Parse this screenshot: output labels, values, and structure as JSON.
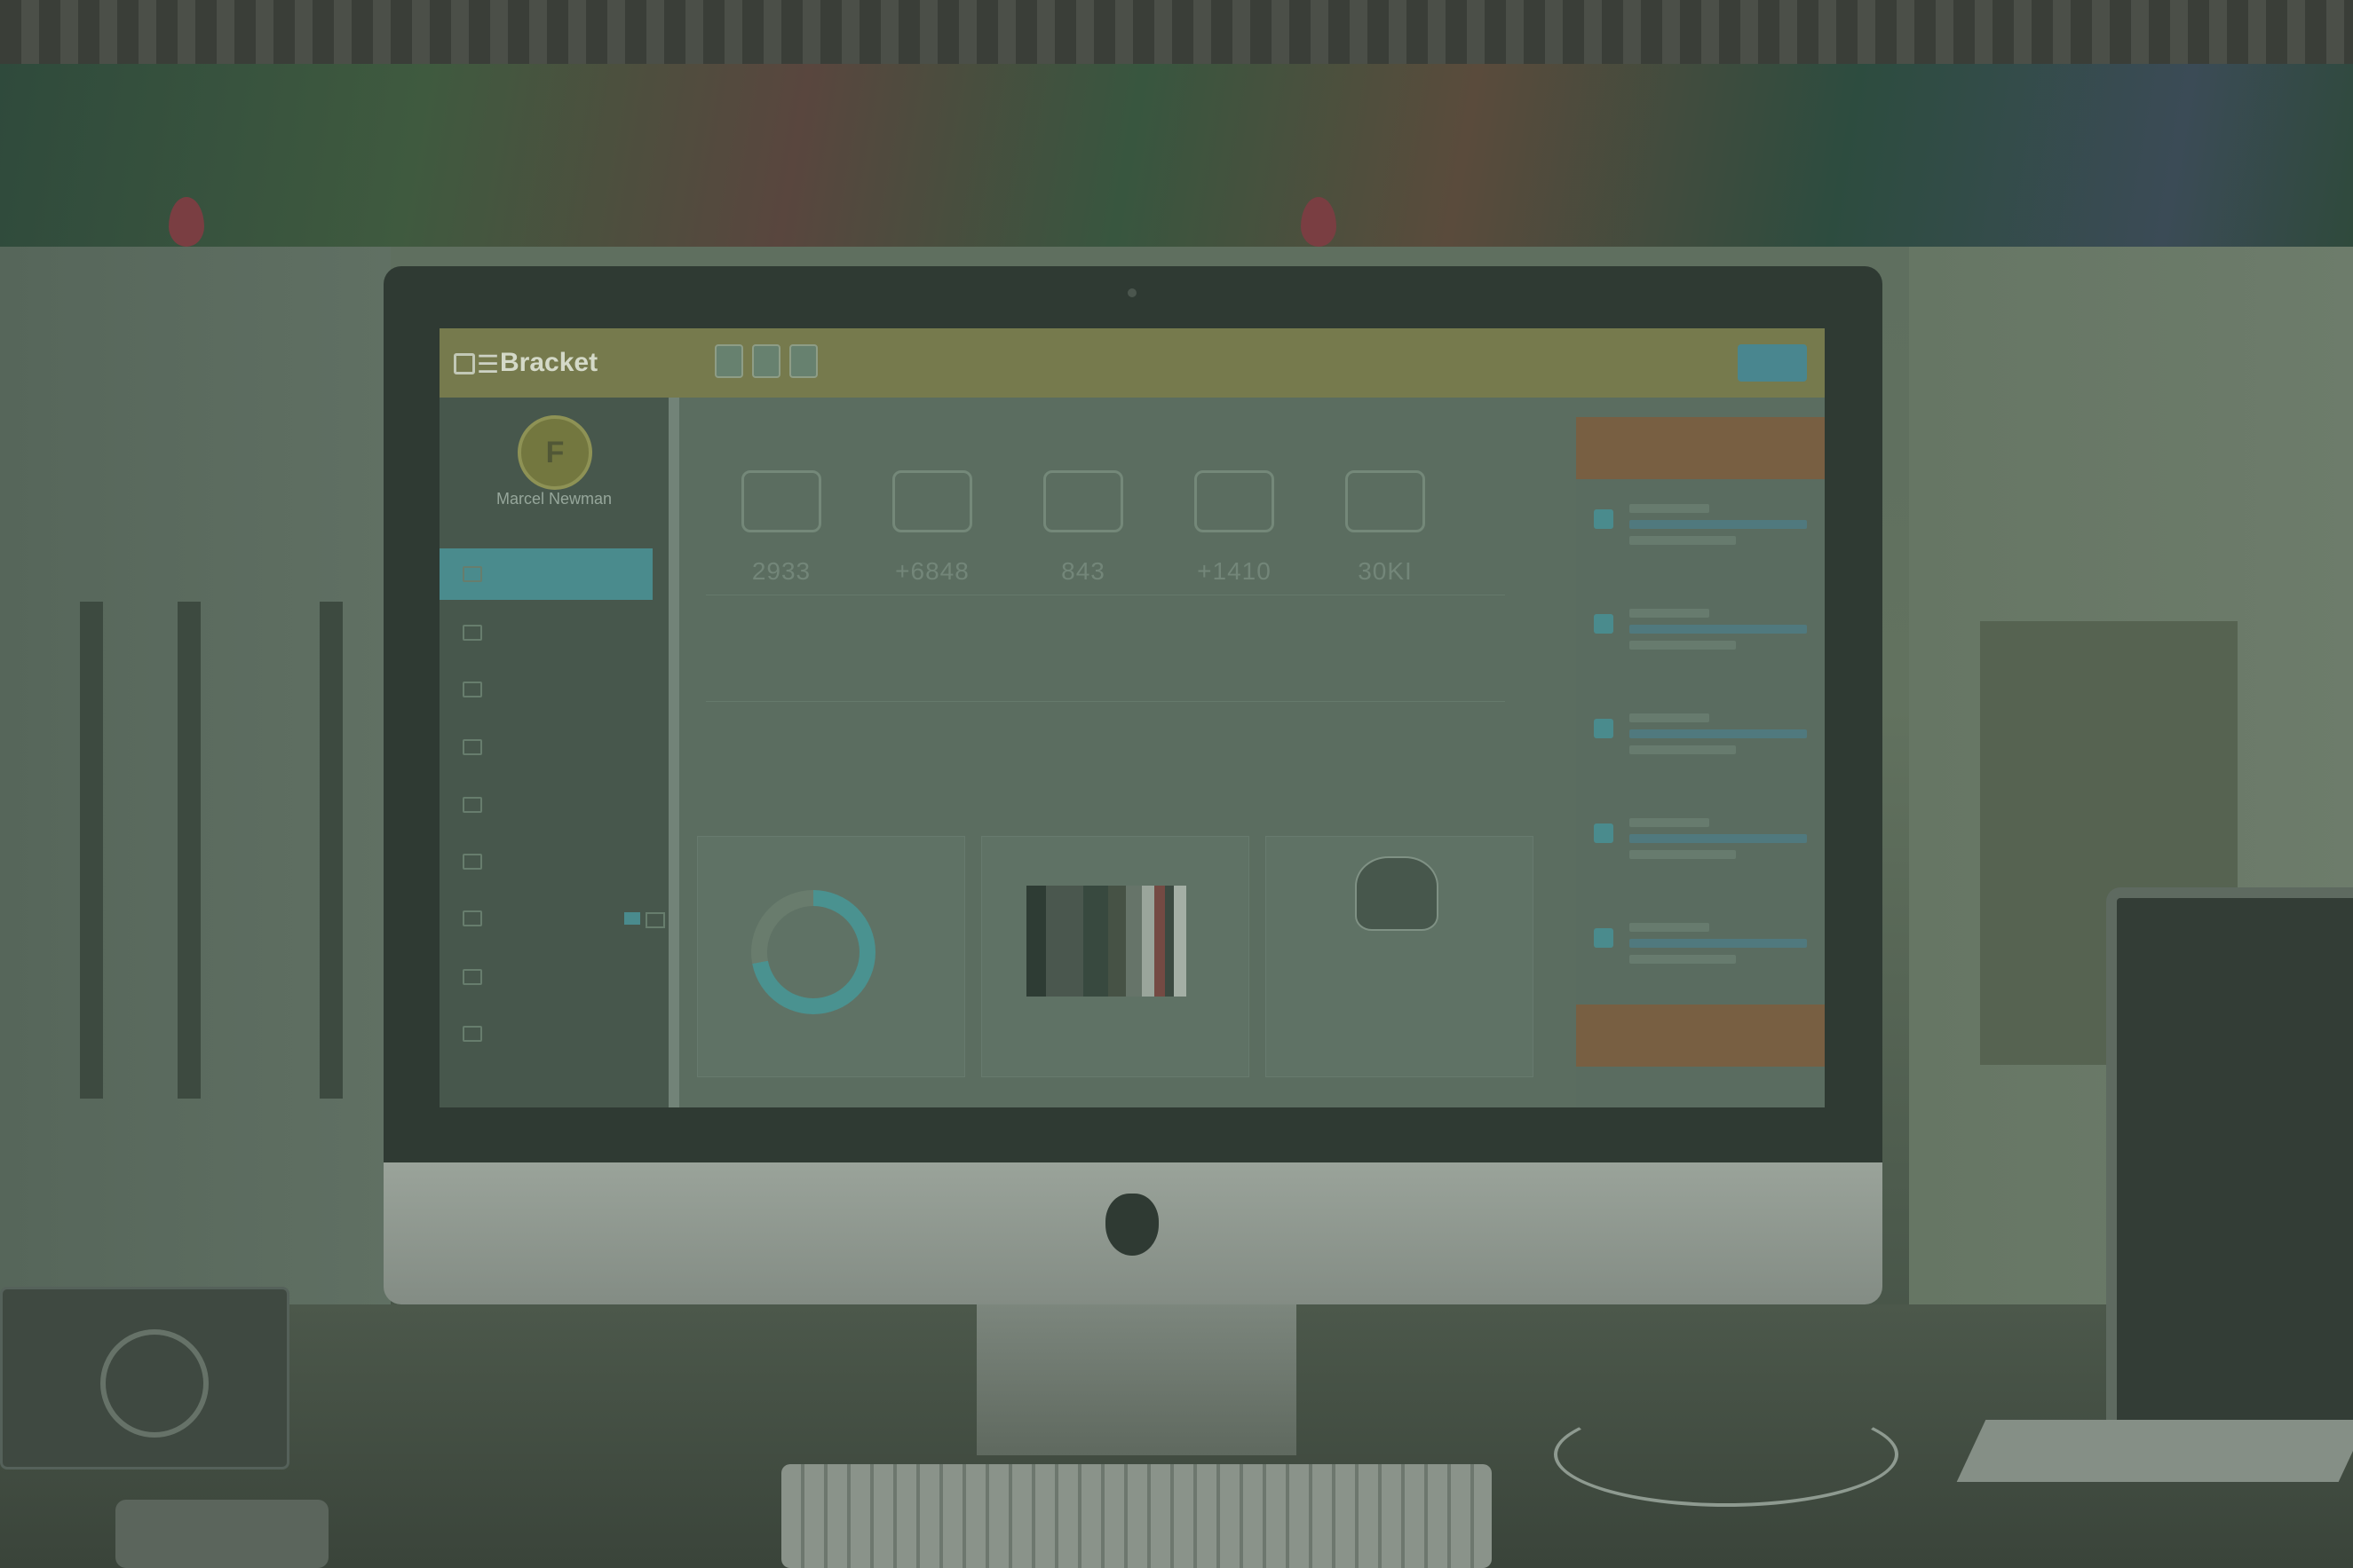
{
  "dashboard": {
    "brand": "Bracket",
    "top_button": "",
    "user": {
      "initials": "F",
      "name": "Marcel Newman"
    },
    "sidebar_items": [
      {
        "label": "",
        "active": true
      },
      {
        "label": "",
        "active": false
      },
      {
        "label": "",
        "active": false
      },
      {
        "label": "",
        "active": false
      },
      {
        "label": "",
        "active": false
      },
      {
        "label": "",
        "active": false
      },
      {
        "label": "",
        "active": false
      },
      {
        "label": "",
        "active": false
      },
      {
        "label": "",
        "active": false
      }
    ],
    "stats": [
      {
        "icon": "heart-icon",
        "value": "2933"
      },
      {
        "icon": "cloud-icon",
        "value": "+6848"
      },
      {
        "icon": "book-icon",
        "value": "843"
      },
      {
        "icon": "newspaper-icon",
        "value": "+1410"
      },
      {
        "icon": "database-icon",
        "value": "30KI"
      }
    ],
    "panels": [
      {
        "title": "",
        "head": ""
      },
      {
        "title": "",
        "head": ""
      },
      {
        "title": "",
        "head": ""
      }
    ],
    "bar_colors": [
      "#2f3b34",
      "#4e5a51",
      "#3a4a40",
      "#4a5447",
      "#6e7a6f",
      "#a7b0a6",
      "#7d4b45",
      "#3f4b42",
      "#b3bbb1"
    ],
    "right_col": {
      "header_top": "",
      "header_bottom": "",
      "feed_count": 5
    }
  },
  "colors": {
    "topbar": "#7f8150",
    "sidebar": "#4b5a4e",
    "accent_teal": "#4e9497",
    "accent_orange": "#826343"
  }
}
